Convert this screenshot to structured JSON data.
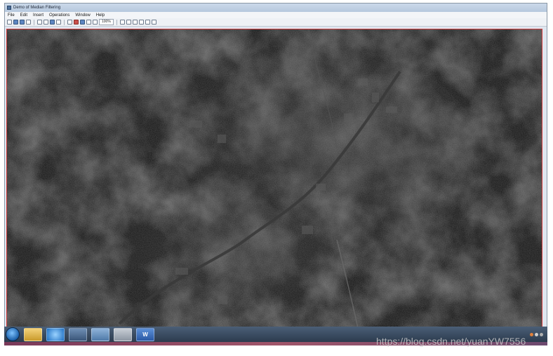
{
  "window": {
    "title": "Demo of Median Filtering"
  },
  "menu": {
    "items": [
      "File",
      "Edit",
      "Insert",
      "Operations",
      "Window",
      "Help"
    ]
  },
  "toolbar": {
    "zoom_value": "100%",
    "icons": [
      "new-icon",
      "open-icon",
      "save-icon",
      "print-icon",
      "undo-icon",
      "cut-icon",
      "copy-icon",
      "paste-icon",
      "pointer-icon",
      "rotate-icon",
      "select-icon",
      "crop-icon",
      "zoom-icon",
      "text-icon",
      "line-icon",
      "rect-icon",
      "ellipse-icon",
      "fill-icon",
      "eyedrop-icon"
    ]
  },
  "taskbar": {
    "apps": [
      "folder-icon",
      "ie-icon",
      "network-icon",
      "matlab-icon",
      "settings-icon",
      "word-icon"
    ],
    "word_label": "W"
  },
  "watermark": {
    "text": "https://blog.csdn.net/yuanYW7556"
  },
  "colors": {
    "canvas_border": "#d13a3a",
    "image_base": "#141414"
  }
}
